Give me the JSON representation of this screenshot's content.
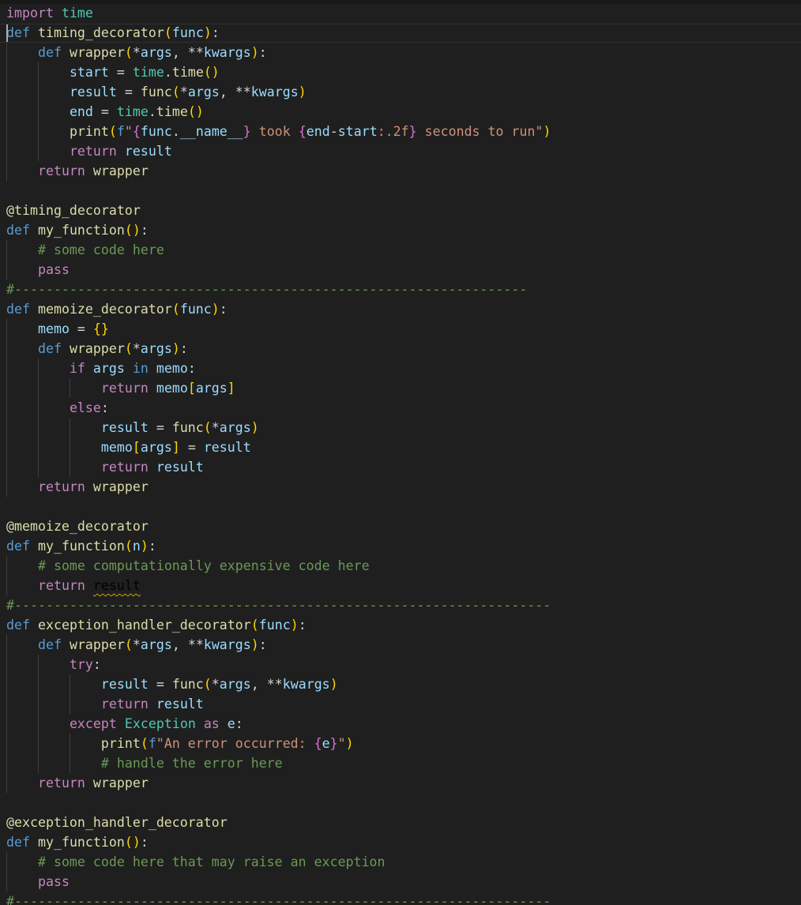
{
  "editor": {
    "language": "python",
    "theme_colors": {
      "background": "#1f1f1f",
      "keyword": "#c586c0",
      "storage": "#569cd6",
      "function": "#dcdcaa",
      "variable": "#9cdcfe",
      "class": "#4ec9b0",
      "string": "#ce9178",
      "comment": "#6a9955",
      "bracket_level_1": "#ffd700",
      "bracket_level_2": "#da70d6",
      "bracket_level_3": "#179fff"
    },
    "cursor_line": 2,
    "lines": [
      [
        [
          "import",
          "kw"
        ],
        [
          " ",
          ""
        ],
        [
          "time",
          "cls"
        ]
      ],
      [
        [
          "def",
          "def"
        ],
        [
          " ",
          ""
        ],
        [
          "timing_decorator",
          "fn"
        ],
        [
          "(",
          "p1"
        ],
        [
          "func",
          "var"
        ],
        [
          ")",
          "p1"
        ],
        [
          ":",
          "op"
        ]
      ],
      [
        [
          "    ",
          ""
        ],
        [
          "def",
          "def"
        ],
        [
          " ",
          ""
        ],
        [
          "wrapper",
          "fn"
        ],
        [
          "(",
          "p1"
        ],
        [
          "*",
          "op"
        ],
        [
          "args",
          "var"
        ],
        [
          ", ",
          "op"
        ],
        [
          "**",
          "op"
        ],
        [
          "kwargs",
          "var"
        ],
        [
          ")",
          "p1"
        ],
        [
          ":",
          "op"
        ]
      ],
      [
        [
          "        ",
          ""
        ],
        [
          "start",
          "var"
        ],
        [
          " = ",
          "op"
        ],
        [
          "time",
          "cls"
        ],
        [
          ".",
          "op"
        ],
        [
          "time",
          "fn"
        ],
        [
          "()",
          "p1"
        ]
      ],
      [
        [
          "        ",
          ""
        ],
        [
          "result",
          "var"
        ],
        [
          " = ",
          "op"
        ],
        [
          "func",
          "fn"
        ],
        [
          "(",
          "p1"
        ],
        [
          "*",
          "op"
        ],
        [
          "args",
          "var"
        ],
        [
          ", ",
          "op"
        ],
        [
          "**",
          "op"
        ],
        [
          "kwargs",
          "var"
        ],
        [
          ")",
          "p1"
        ]
      ],
      [
        [
          "        ",
          ""
        ],
        [
          "end",
          "var"
        ],
        [
          " = ",
          "op"
        ],
        [
          "time",
          "cls"
        ],
        [
          ".",
          "op"
        ],
        [
          "time",
          "fn"
        ],
        [
          "()",
          "p1"
        ]
      ],
      [
        [
          "        ",
          ""
        ],
        [
          "print",
          "fn"
        ],
        [
          "(",
          "p1"
        ],
        [
          "f",
          "interp"
        ],
        [
          "\"",
          "str"
        ],
        [
          "{",
          "p2"
        ],
        [
          "func",
          "var"
        ],
        [
          ".",
          "op"
        ],
        [
          "__name__",
          "var"
        ],
        [
          "}",
          "p2"
        ],
        [
          " took ",
          "str"
        ],
        [
          "{",
          "p2"
        ],
        [
          "end",
          "var"
        ],
        [
          "-",
          "op"
        ],
        [
          "start",
          "var"
        ],
        [
          ":.2f",
          "str"
        ],
        [
          "}",
          "p2"
        ],
        [
          " seconds to run\"",
          "str"
        ],
        [
          ")",
          "p1"
        ]
      ],
      [
        [
          "        ",
          ""
        ],
        [
          "return",
          "kw"
        ],
        [
          " ",
          ""
        ],
        [
          "result",
          "var"
        ]
      ],
      [
        [
          "    ",
          ""
        ],
        [
          "return",
          "kw"
        ],
        [
          " ",
          ""
        ],
        [
          "wrapper",
          "fn"
        ]
      ],
      [],
      [
        [
          "@timing_decorator",
          "dec"
        ]
      ],
      [
        [
          "def",
          "def"
        ],
        [
          " ",
          ""
        ],
        [
          "my_function",
          "fn"
        ],
        [
          "()",
          "p1"
        ],
        [
          ":",
          "op"
        ]
      ],
      [
        [
          "    ",
          ""
        ],
        [
          "# some code here",
          "cm"
        ]
      ],
      [
        [
          "    ",
          ""
        ],
        [
          "pass",
          "kw"
        ]
      ],
      [
        [
          "#-----------------------------------------------------------------",
          "cm"
        ]
      ],
      [
        [
          "def",
          "def"
        ],
        [
          " ",
          ""
        ],
        [
          "memoize_decorator",
          "fn"
        ],
        [
          "(",
          "p1"
        ],
        [
          "func",
          "var"
        ],
        [
          ")",
          "p1"
        ],
        [
          ":",
          "op"
        ]
      ],
      [
        [
          "    ",
          ""
        ],
        [
          "memo",
          "var"
        ],
        [
          " = ",
          "op"
        ],
        [
          "{}",
          "p1"
        ]
      ],
      [
        [
          "    ",
          ""
        ],
        [
          "def",
          "def"
        ],
        [
          " ",
          ""
        ],
        [
          "wrapper",
          "fn"
        ],
        [
          "(",
          "p1"
        ],
        [
          "*",
          "op"
        ],
        [
          "args",
          "var"
        ],
        [
          ")",
          "p1"
        ],
        [
          ":",
          "op"
        ]
      ],
      [
        [
          "        ",
          ""
        ],
        [
          "if",
          "kw"
        ],
        [
          " ",
          ""
        ],
        [
          "args",
          "var"
        ],
        [
          " ",
          ""
        ],
        [
          "in",
          "def"
        ],
        [
          " ",
          ""
        ],
        [
          "memo",
          "var"
        ],
        [
          ":",
          "op"
        ]
      ],
      [
        [
          "            ",
          ""
        ],
        [
          "return",
          "kw"
        ],
        [
          " ",
          ""
        ],
        [
          "memo",
          "var"
        ],
        [
          "[",
          "p1"
        ],
        [
          "args",
          "var"
        ],
        [
          "]",
          "p1"
        ]
      ],
      [
        [
          "        ",
          ""
        ],
        [
          "else",
          "kw"
        ],
        [
          ":",
          "op"
        ]
      ],
      [
        [
          "            ",
          ""
        ],
        [
          "result",
          "var"
        ],
        [
          " = ",
          "op"
        ],
        [
          "func",
          "fn"
        ],
        [
          "(",
          "p1"
        ],
        [
          "*",
          "op"
        ],
        [
          "args",
          "var"
        ],
        [
          ")",
          "p1"
        ]
      ],
      [
        [
          "            ",
          ""
        ],
        [
          "memo",
          "var"
        ],
        [
          "[",
          "p1"
        ],
        [
          "args",
          "var"
        ],
        [
          "]",
          "p1"
        ],
        [
          " = ",
          "op"
        ],
        [
          "result",
          "var"
        ]
      ],
      [
        [
          "            ",
          ""
        ],
        [
          "return",
          "kw"
        ],
        [
          " ",
          ""
        ],
        [
          "result",
          "var"
        ]
      ],
      [
        [
          "    ",
          ""
        ],
        [
          "return",
          "kw"
        ],
        [
          " ",
          ""
        ],
        [
          "wrapper",
          "fn"
        ]
      ],
      [],
      [
        [
          "@memoize_decorator",
          "dec"
        ]
      ],
      [
        [
          "def",
          "def"
        ],
        [
          " ",
          ""
        ],
        [
          "my_function",
          "fn"
        ],
        [
          "(",
          "p1"
        ],
        [
          "n",
          "var"
        ],
        [
          ")",
          "p1"
        ],
        [
          ":",
          "op"
        ]
      ],
      [
        [
          "    ",
          ""
        ],
        [
          "# some computationally expensive code here",
          "cm"
        ]
      ],
      [
        [
          "    ",
          ""
        ],
        [
          "return",
          "kw"
        ],
        [
          " ",
          ""
        ],
        [
          "result",
          "squiggle"
        ]
      ],
      [
        [
          "#--------------------------------------------------------------------",
          "cm"
        ]
      ],
      [
        [
          "def",
          "def"
        ],
        [
          " ",
          ""
        ],
        [
          "exception_handler_decorator",
          "fn"
        ],
        [
          "(",
          "p1"
        ],
        [
          "func",
          "var"
        ],
        [
          ")",
          "p1"
        ],
        [
          ":",
          "op"
        ]
      ],
      [
        [
          "    ",
          ""
        ],
        [
          "def",
          "def"
        ],
        [
          " ",
          ""
        ],
        [
          "wrapper",
          "fn"
        ],
        [
          "(",
          "p1"
        ],
        [
          "*",
          "op"
        ],
        [
          "args",
          "var"
        ],
        [
          ", ",
          "op"
        ],
        [
          "**",
          "op"
        ],
        [
          "kwargs",
          "var"
        ],
        [
          ")",
          "p1"
        ],
        [
          ":",
          "op"
        ]
      ],
      [
        [
          "        ",
          ""
        ],
        [
          "try",
          "kw"
        ],
        [
          ":",
          "op"
        ]
      ],
      [
        [
          "            ",
          ""
        ],
        [
          "result",
          "var"
        ],
        [
          " = ",
          "op"
        ],
        [
          "func",
          "fn"
        ],
        [
          "(",
          "p1"
        ],
        [
          "*",
          "op"
        ],
        [
          "args",
          "var"
        ],
        [
          ", ",
          "op"
        ],
        [
          "**",
          "op"
        ],
        [
          "kwargs",
          "var"
        ],
        [
          ")",
          "p1"
        ]
      ],
      [
        [
          "            ",
          ""
        ],
        [
          "return",
          "kw"
        ],
        [
          " ",
          ""
        ],
        [
          "result",
          "var"
        ]
      ],
      [
        [
          "        ",
          ""
        ],
        [
          "except",
          "kw"
        ],
        [
          " ",
          ""
        ],
        [
          "Exception",
          "cls"
        ],
        [
          " ",
          ""
        ],
        [
          "as",
          "kw"
        ],
        [
          " ",
          ""
        ],
        [
          "e",
          "var"
        ],
        [
          ":",
          "op"
        ]
      ],
      [
        [
          "            ",
          ""
        ],
        [
          "print",
          "fn"
        ],
        [
          "(",
          "p1"
        ],
        [
          "f",
          "interp"
        ],
        [
          "\"An error occurred: ",
          "str"
        ],
        [
          "{",
          "p2"
        ],
        [
          "e",
          "var"
        ],
        [
          "}",
          "p2"
        ],
        [
          "\"",
          "str"
        ],
        [
          ")",
          "p1"
        ]
      ],
      [
        [
          "            ",
          ""
        ],
        [
          "# handle the error here",
          "cm"
        ]
      ],
      [
        [
          "    ",
          ""
        ],
        [
          "return",
          "kw"
        ],
        [
          " ",
          ""
        ],
        [
          "wrapper",
          "fn"
        ]
      ],
      [],
      [
        [
          "@exception_handler_decorator",
          "dec"
        ]
      ],
      [
        [
          "def",
          "def"
        ],
        [
          " ",
          ""
        ],
        [
          "my_function",
          "fn"
        ],
        [
          "()",
          "p1"
        ],
        [
          ":",
          "op"
        ]
      ],
      [
        [
          "    ",
          ""
        ],
        [
          "# some code here that may raise an exception",
          "cm"
        ]
      ],
      [
        [
          "    ",
          ""
        ],
        [
          "pass",
          "kw"
        ]
      ],
      [
        [
          "#--------------------------------------------------------------------",
          "cm"
        ]
      ]
    ]
  }
}
